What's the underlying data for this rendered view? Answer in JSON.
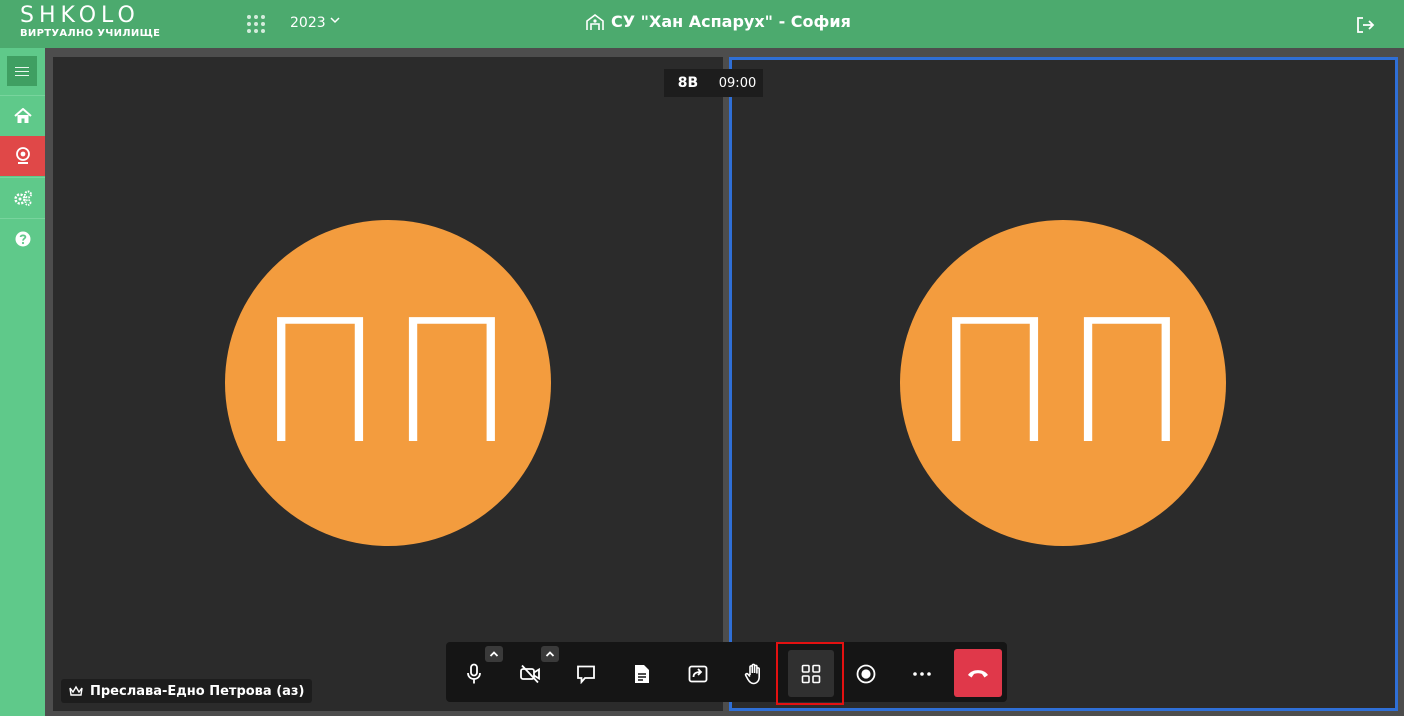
{
  "header": {
    "logo_text": "SHKOLO",
    "logo_subtitle": "ВИРТУАЛНО УЧИЛИЩЕ",
    "year": "2023",
    "school_name": "СУ \"Хан Аспарух\" - София"
  },
  "sidebar": {
    "items": [
      {
        "icon": "home-icon",
        "active": false
      },
      {
        "icon": "webcam-icon",
        "active": true
      },
      {
        "icon": "gears-icon",
        "active": false
      },
      {
        "icon": "help-icon",
        "active": false
      }
    ]
  },
  "meeting": {
    "class_label": "8В",
    "time": "09:00",
    "participants": [
      {
        "initials": "ПП",
        "avatar_color": "#f39c3e"
      },
      {
        "initials": "ПП",
        "avatar_color": "#f39c3e",
        "active_speaker": true
      }
    ],
    "local_name": "Преслава-Едно Петрова (аз)"
  },
  "toolbar": {
    "buttons": [
      "microphone-icon",
      "camera-off-icon",
      "chat-icon",
      "document-icon",
      "share-screen-icon",
      "raise-hand-icon",
      "tile-view-icon",
      "record-icon",
      "more-icon",
      "hangup-icon"
    ],
    "highlighted": "tile-view-icon"
  },
  "colors": {
    "header": "#4caa6e",
    "sidebar": "#5fc98a",
    "active_sidebar": "#e04848",
    "avatar": "#f39c3e",
    "active_speaker_border": "#2f6fd6",
    "hangup": "#e0384a",
    "highlight": "#e31111"
  }
}
